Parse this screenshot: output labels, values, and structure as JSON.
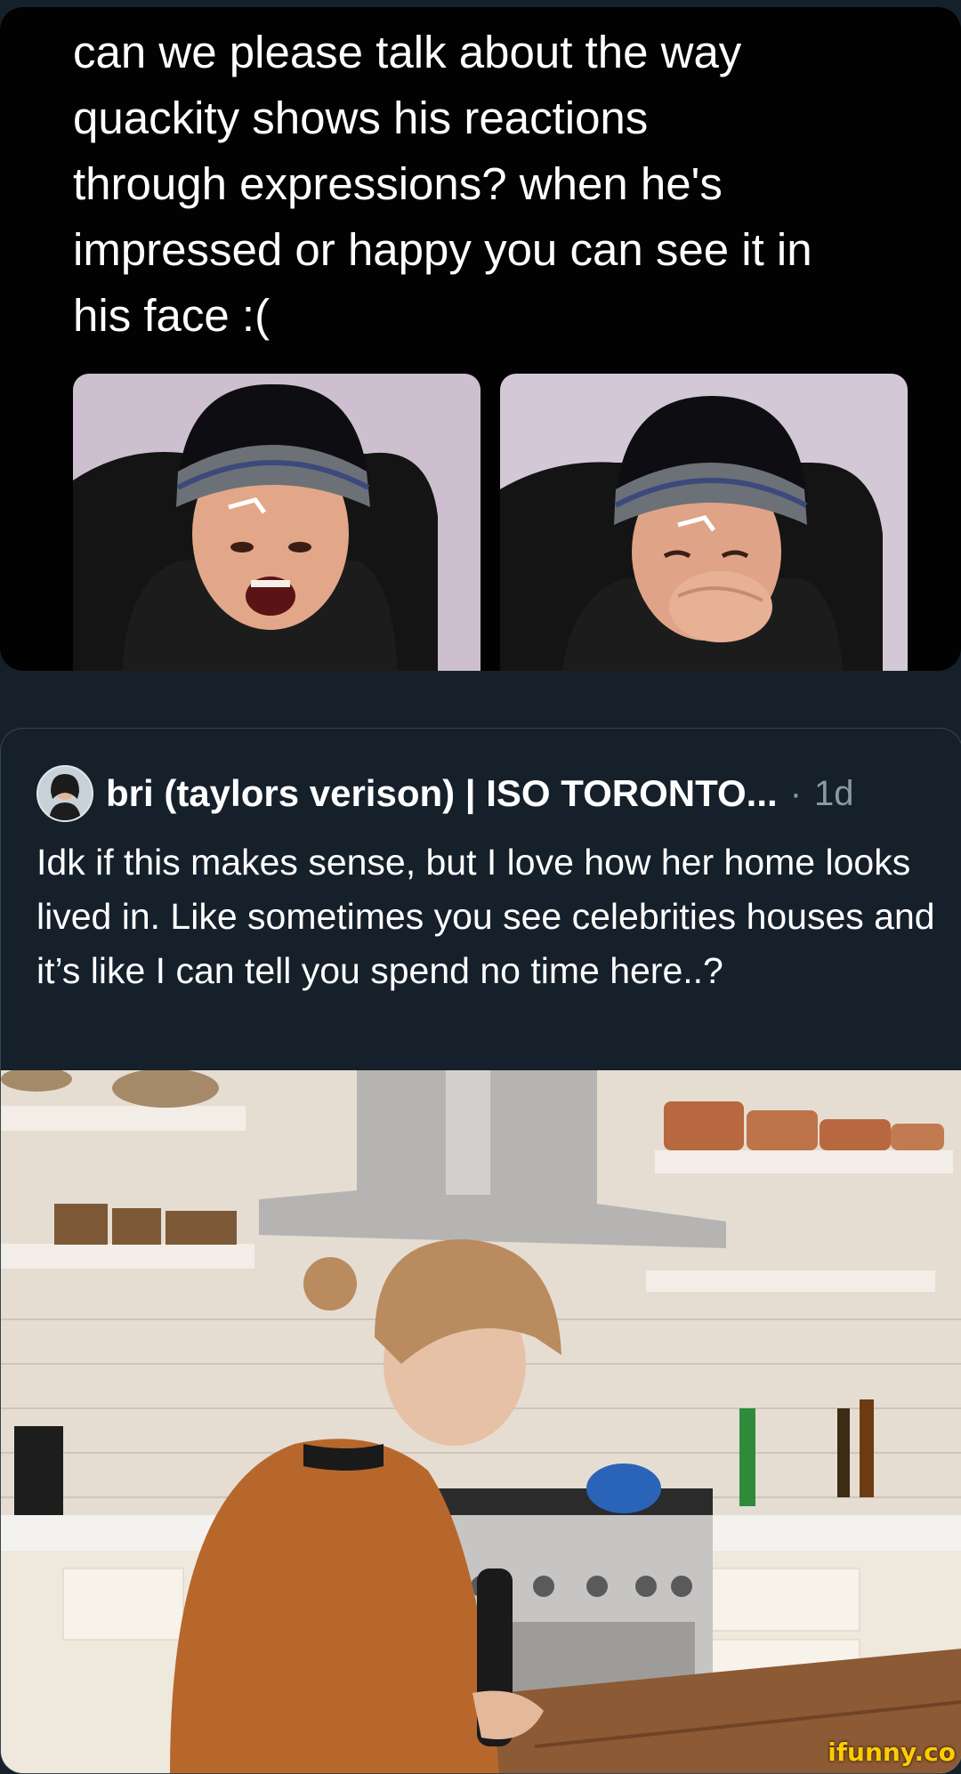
{
  "quote_tweet": {
    "text": "can we please talk about the way\nquackity shows his reactions\nthrough expressions? when he's\nimpressed or happy you can see it in\nhis face :("
  },
  "tweet": {
    "author": "bri (taylors verison) | ISO TORONTO...",
    "separator": "·",
    "timestamp": "1d",
    "text": "Idk if this makes sense, but I love how her home looks lived in. Like sometimes you see celebrities houses and it’s like I can tell you spend no time here..?"
  },
  "watermark": "ifunny.co"
}
